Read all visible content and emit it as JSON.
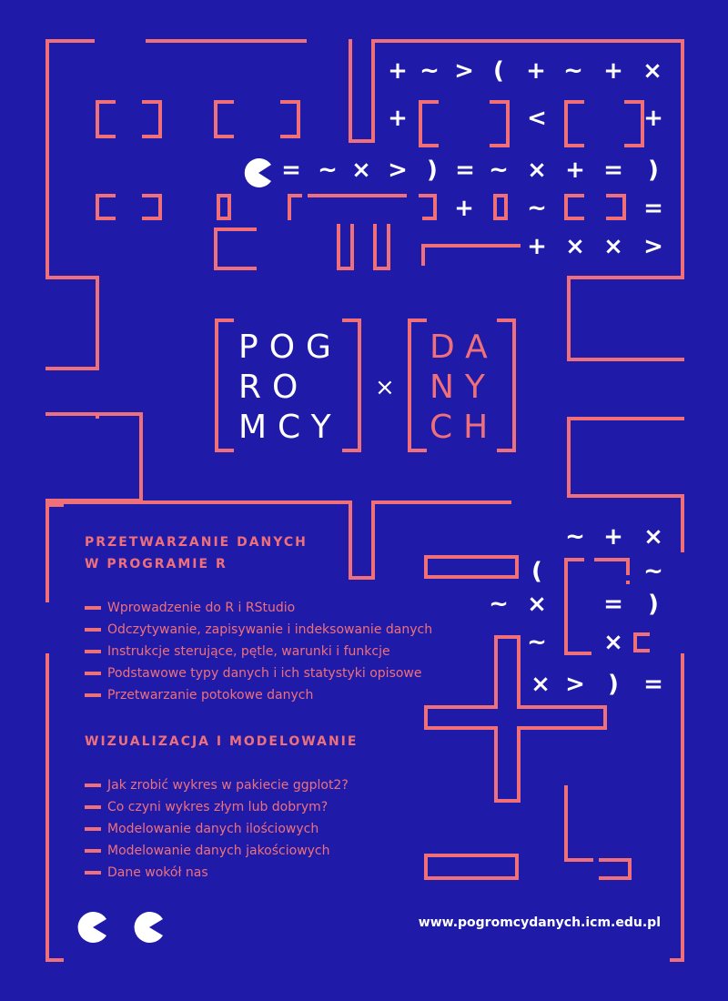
{
  "logo": {
    "left_lines": [
      "POG",
      "RO",
      "MCY"
    ],
    "right_lines": [
      "DA",
      "NY",
      "CH"
    ],
    "separator": "×"
  },
  "symbols": {
    "row1": [
      "+",
      "~",
      ">",
      "(",
      "+",
      "~",
      "+",
      "×"
    ],
    "row2": [
      "+",
      "<",
      "+"
    ],
    "row3": [
      "=",
      "~",
      "×",
      ">",
      ")",
      "=",
      "~",
      "×",
      "+",
      "=",
      ")"
    ],
    "row4": [
      "+",
      "~",
      "="
    ],
    "row5": [
      "+",
      "×",
      "×",
      ">"
    ],
    "right_block": [
      "~",
      "+",
      "×",
      "(",
      "~",
      "~",
      "×",
      "=",
      ")",
      "~",
      "×",
      "×",
      ">",
      ")",
      "="
    ]
  },
  "section1": {
    "heading_line1": "PRZETWARZANIE DANYCH",
    "heading_line2": "W PROGRAMIE R",
    "items": [
      "Wprowadzenie do R i RStudio",
      "Odczytywanie, zapisywanie i indeksowanie danych",
      "Instrukcje sterujące, pętle, warunki i funkcje",
      "Podstawowe typy danych i ich statystyki opisowe",
      "Przetwarzanie potokowe danych"
    ]
  },
  "section2": {
    "heading": "WIZUALIZACJA I MODELOWANIE",
    "items": [
      "Jak zrobić wykres w pakiecie ggplot2?",
      "Co czyni wykres złym lub dobrym?",
      "Modelowanie danych ilościowych",
      "Modelowanie danych jakościowych",
      "Dane wokół nas"
    ]
  },
  "url": "www.pogromcydanych.icm.edu.pl",
  "colors": {
    "background": "#1f1ba8",
    "accent": "#f0707a",
    "foreground": "#ffffff"
  }
}
